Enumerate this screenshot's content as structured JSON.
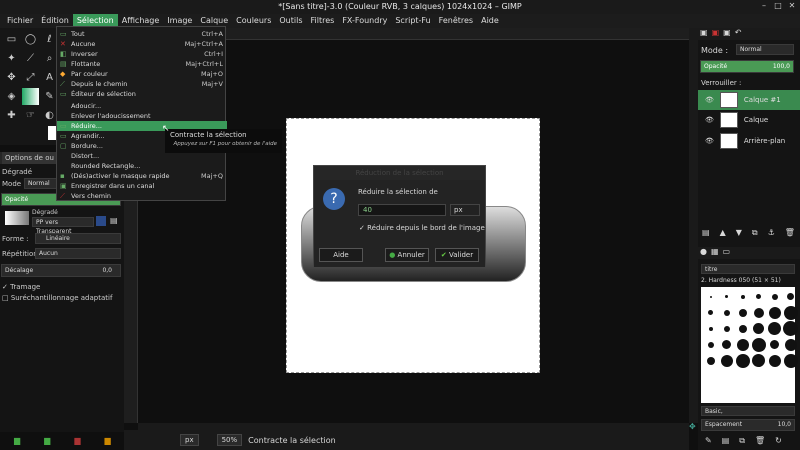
{
  "window": {
    "title": "*[Sans titre]-3.0 (Couleur RVB, 3 calques) 1024x1024 – GIMP"
  },
  "menubar": [
    "Fichier",
    "Édition",
    "Sélection",
    "Affichage",
    "Image",
    "Calque",
    "Couleurs",
    "Outils",
    "Filtres",
    "FX-Foundry",
    "Script-Fu",
    "Fenêtres",
    "Aide"
  ],
  "selection_menu": [
    {
      "label": "Tout",
      "shortcut": "Ctrl+A"
    },
    {
      "label": "Aucune",
      "shortcut": "Maj+Ctrl+A"
    },
    {
      "label": "Inverser",
      "shortcut": "Ctrl+I"
    },
    {
      "label": "Flottante",
      "shortcut": "Maj+Ctrl+L"
    },
    {
      "label": "Par couleur",
      "shortcut": "Maj+O"
    },
    {
      "label": "Depuis le chemin",
      "shortcut": "Maj+V"
    },
    {
      "label": "Éditeur de sélection",
      "shortcut": ""
    },
    {
      "label": "Adoucir...",
      "shortcut": ""
    },
    {
      "label": "Enlever l'adoucissement",
      "shortcut": ""
    },
    {
      "label": "Réduire...",
      "shortcut": ""
    },
    {
      "label": "Agrandir...",
      "shortcut": ""
    },
    {
      "label": "Bordure...",
      "shortcut": ""
    },
    {
      "label": "Distort...",
      "shortcut": ""
    },
    {
      "label": "Rounded Rectangle...",
      "shortcut": ""
    },
    {
      "label": "(Dés)activer le masque rapide",
      "shortcut": "Maj+Q"
    },
    {
      "label": "Enregistrer dans un canal",
      "shortcut": ""
    },
    {
      "label": "Vers chemin",
      "shortcut": ""
    }
  ],
  "tooltip": {
    "title": "Contracte la sélection",
    "hint": "Appuyez sur F1 pour obtenir de l'aide"
  },
  "tool_options": {
    "tab_label": "Options de ou",
    "tool_name": "Dégradé",
    "mode_label": "Mode :",
    "mode_value": "Normal",
    "opacity_label": "Opacité",
    "gradient_label": "Dégradé",
    "gradient_value": "PP vers Transparent",
    "shape_label": "Forme :",
    "shape_value": "Linéaire",
    "repeat_label": "Répétition :",
    "repeat_value": "Aucun",
    "offset_label": "Décalage",
    "offset_value": "0,0",
    "dither_label": "Tramage",
    "adaptive_label": "Suréchantillonnage adaptatif"
  },
  "dialog": {
    "title": "Réduction de la sélection",
    "prompt": "Réduire la sélection de",
    "value": "40",
    "unit": "px",
    "checkbox_label": "Réduire depuis le bord de l'image",
    "help": "Aide",
    "cancel": "Annuler",
    "ok": "Valider"
  },
  "layers_panel": {
    "mode_label": "Mode :",
    "mode_value": "Normal",
    "opacity_label": "Opacité",
    "opacity_value": "100,0",
    "lock_label": "Verrouiller :",
    "layers": [
      {
        "name": "Calque #1"
      },
      {
        "name": "Calque"
      },
      {
        "name": "Arrière-plan"
      }
    ]
  },
  "brushes_panel": {
    "filter_label": "titre",
    "brush_name": "2. Hardness 050 (51 × 51)",
    "preset": "Basic,",
    "spacing_label": "Espacement",
    "spacing_value": "10,0"
  },
  "statusbar": {
    "unit": "px",
    "zoom": "50%",
    "message": "Contracte la sélection"
  }
}
